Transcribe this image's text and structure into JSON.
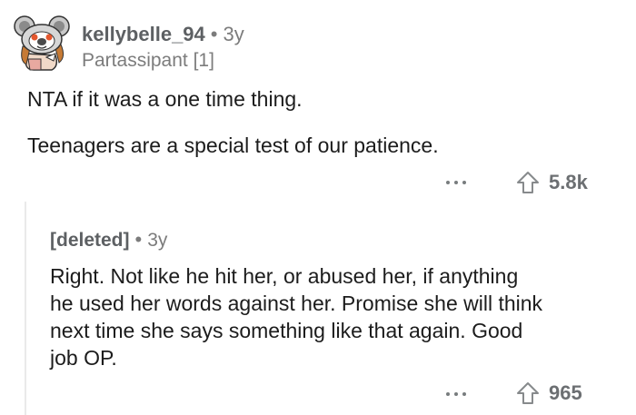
{
  "comment": {
    "username": "kellybelle_94",
    "separator": "•",
    "age": "3y",
    "flair": "Partassipant [1]",
    "body_lines": [
      "NTA if it was a one time thing.",
      "Teenagers are a special test of our patience."
    ],
    "upvotes": "5.8k"
  },
  "reply": {
    "username": "[deleted]",
    "separator": "•",
    "age": "3y",
    "body_lines": [
      "Right. Not like he hit her, or abused her, if anything",
      "he used her words against her. Promise she will think",
      "next time she says something like that again. Good",
      "job OP."
    ],
    "upvotes": "965"
  },
  "icons": {
    "avatar": "koala-snoo-avatar",
    "more": "more-options-icon",
    "upvote": "upvote-arrow-icon"
  },
  "colors": {
    "username": "#5d6063",
    "meta": "#7c7c7c",
    "body": "#1c1c1c",
    "thread_line": "#eaeaea"
  }
}
